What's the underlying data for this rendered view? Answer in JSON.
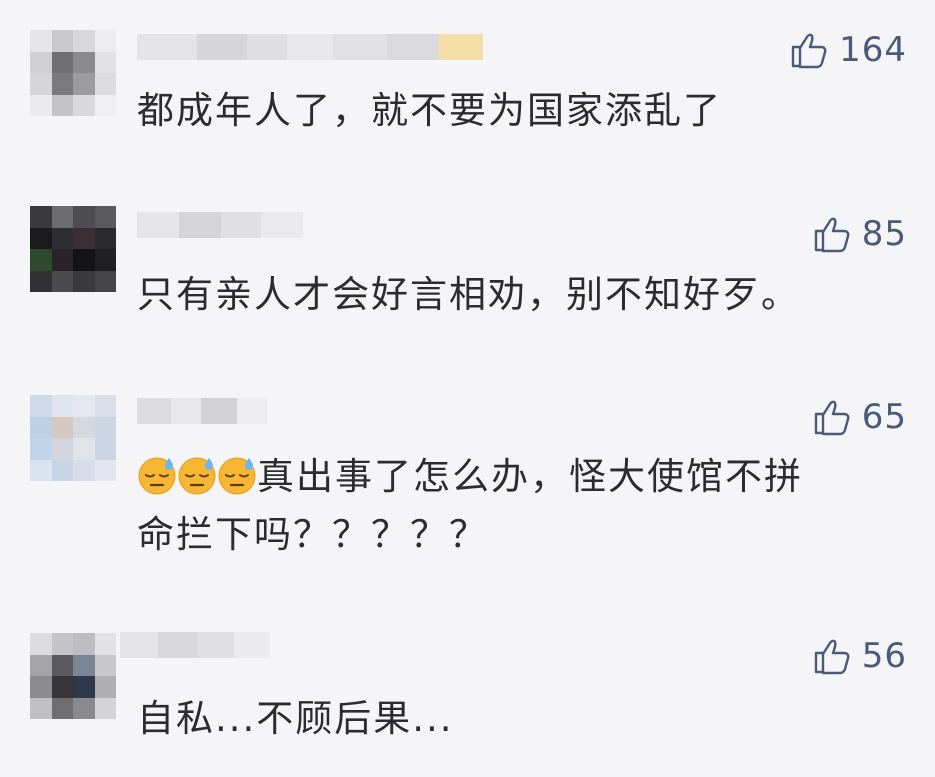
{
  "comments": [
    {
      "likes": "164",
      "text": "都成年人了，就不要为国家添乱了"
    },
    {
      "likes": "85",
      "text": "只有亲人才会好言相劝，别不知好歹。"
    },
    {
      "likes": "65",
      "text_line1": "真出事了怎么办，怪大使馆不拼",
      "text_line2": "命拦下吗？？？？？",
      "emoji_count": 3
    },
    {
      "likes": "56",
      "text": "自私...不顾后果..."
    }
  ],
  "icons": {
    "like": "thumbs-up-icon",
    "emoji": "downcast-face-with-sweat-emoji"
  },
  "colors": {
    "background": "#f5f5f7",
    "like_text": "#4a5a78",
    "comment_text": "#2c2c2c"
  }
}
